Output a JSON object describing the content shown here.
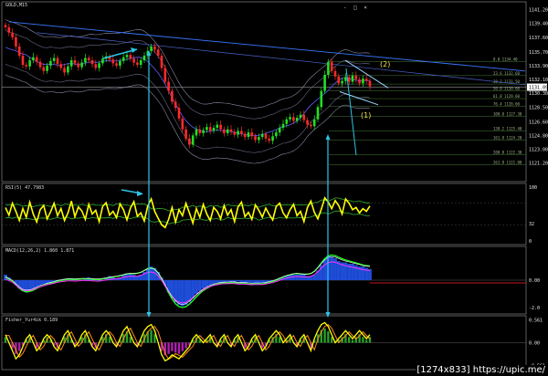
{
  "window": {
    "title": "GOLD,M15",
    "buttons": [
      "-",
      "□",
      "×"
    ]
  },
  "panels": {
    "rsi_title": "RSI(5) 47.7983",
    "macd_title": "MACD(12,26,2) 1.860 1.871",
    "fisher_title": "Fisher_Yur4ik 0.189"
  },
  "wave_labels": [
    "(2)",
    "(1)"
  ],
  "watermark": "[1274x833] https://upic.me/",
  "colors": {
    "background": "#000000",
    "bull_candle": "#22e022",
    "bear_candle": "#ff2a2a",
    "trendline": "#3a78ff",
    "arrow": "#2ec4e6",
    "rsi_line": "#ffff00",
    "fisher_line": "#ffff00",
    "macd_hist": "#1e4dd8",
    "fib": "#4a7a3a"
  },
  "chart_data": [
    {
      "type": "candlestick",
      "name": "price",
      "ylim": [
        1119.5,
        1141.5
      ],
      "y_ticks": [
        "1141.20",
        "1139.40",
        "1137.60",
        "1135.70",
        "1133.90",
        "1132.10",
        "1130.30",
        "1128.50",
        "1126.60",
        "1124.80",
        "1123.00",
        "1121.20"
      ],
      "highlight_price": "1131.09",
      "fib_levels": [
        {
          "label": "0.0",
          "value": 1134.4
        },
        {
          "label": "23.6",
          "value": 1132.6
        },
        {
          "label": "38.2",
          "value": 1131.5
        },
        {
          "label": "50.0",
          "value": 1130.6
        },
        {
          "label": "61.8",
          "value": 1129.6
        },
        {
          "label": "76.4",
          "value": 1128.6
        },
        {
          "label": "100.0",
          "value": 1127.3
        },
        {
          "label": "138.2",
          "value": 1125.4
        },
        {
          "label": "161.8",
          "value": 1124.2
        },
        {
          "label": "200.0",
          "value": 1122.3
        },
        {
          "label": "261.8",
          "value": 1121.0
        }
      ],
      "close": [
        1138.9,
        1138.2,
        1137.6,
        1136.4,
        1135.2,
        1134.0,
        1133.8,
        1134.6,
        1135.0,
        1134.4,
        1133.7,
        1133.2,
        1133.9,
        1134.5,
        1134.9,
        1134.1,
        1133.6,
        1133.0,
        1133.8,
        1134.6,
        1134.2,
        1133.7,
        1134.3,
        1134.9,
        1134.6,
        1134.1,
        1133.6,
        1134.2,
        1134.8,
        1135.1,
        1134.7,
        1134.2,
        1133.9,
        1134.5,
        1135.0,
        1135.3,
        1134.8,
        1134.3,
        1134.0,
        1134.6,
        1135.2,
        1135.8,
        1136.4,
        1136.0,
        1135.2,
        1133.6,
        1131.8,
        1130.6,
        1129.2,
        1128.4,
        1127.0,
        1125.6,
        1124.4,
        1123.6,
        1124.8,
        1125.6,
        1125.1,
        1125.5,
        1125.9,
        1125.4,
        1125.8,
        1126.2,
        1125.6,
        1125.1,
        1125.6,
        1125.3,
        1124.9,
        1125.4,
        1125.0,
        1124.6,
        1125.2,
        1124.7,
        1124.2,
        1124.6,
        1125.0,
        1124.4,
        1124.1,
        1124.7,
        1125.2,
        1125.8,
        1126.3,
        1126.9,
        1127.2,
        1126.7,
        1127.1,
        1127.5,
        1126.8,
        1126.2,
        1126.0,
        1126.9,
        1128.5,
        1130.6,
        1132.7,
        1134.4,
        1133.2,
        1132.5,
        1131.6,
        1131.9,
        1132.4,
        1131.8,
        1132.6,
        1132.1,
        1131.6,
        1132.2,
        1131.9,
        1131.2
      ]
    },
    {
      "type": "line",
      "name": "RSI",
      "ylim": [
        0,
        100
      ],
      "y_ticks": [
        "100",
        "32",
        "0"
      ],
      "values": [
        62,
        48,
        70,
        55,
        38,
        60,
        44,
        72,
        50,
        35,
        58,
        66,
        41,
        54,
        70,
        47,
        60,
        38,
        52,
        74,
        45,
        63,
        56,
        40,
        68,
        50,
        57,
        36,
        64,
        71,
        48,
        55,
        43,
        69,
        58,
        39,
        61,
        73,
        46,
        52,
        37,
        65,
        78,
        55,
        42,
        30,
        25,
        40,
        62,
        35,
        58,
        47,
        70,
        52,
        33,
        60,
        44,
        68,
        50,
        38,
        62,
        55,
        41,
        66,
        48,
        58,
        36,
        63,
        72,
        45,
        53,
        40,
        67,
        57,
        44,
        61,
        49,
        39,
        64,
        70,
        52,
        43,
        58,
        68,
        47,
        55,
        36,
        62,
        74,
        53,
        41,
        59,
        80,
        72,
        60,
        75,
        66,
        50,
        78,
        70,
        58,
        62,
        52,
        60,
        55,
        65
      ]
    },
    {
      "type": "bar",
      "name": "MACD",
      "ylim": [
        -2.2,
        2.2
      ],
      "y_ticks": [
        "0.00",
        "-2.0"
      ],
      "values": [
        0.4,
        0.2,
        0.0,
        -0.3,
        -0.6,
        -0.8,
        -0.9,
        -0.8,
        -0.6,
        -0.5,
        -0.4,
        -0.3,
        -0.3,
        -0.2,
        -0.1,
        -0.1,
        0.0,
        0.1,
        0.0,
        0.1,
        0.1,
        0.0,
        0.0,
        0.1,
        0.2,
        0.1,
        0.0,
        -0.1,
        0.0,
        0.2,
        0.3,
        0.2,
        0.1,
        0.2,
        0.4,
        0.5,
        0.5,
        0.4,
        0.3,
        0.4,
        0.6,
        0.8,
        1.0,
        0.9,
        0.6,
        0.2,
        -0.4,
        -0.9,
        -1.3,
        -1.6,
        -1.8,
        -1.9,
        -1.8,
        -1.6,
        -1.3,
        -1.0,
        -0.8,
        -0.6,
        -0.5,
        -0.4,
        -0.3,
        -0.2,
        -0.2,
        -0.2,
        -0.1,
        -0.2,
        -0.2,
        -0.1,
        -0.2,
        -0.3,
        -0.2,
        -0.2,
        -0.3,
        -0.3,
        -0.2,
        -0.2,
        -0.2,
        -0.1,
        0.0,
        0.1,
        0.2,
        0.3,
        0.4,
        0.4,
        0.4,
        0.5,
        0.4,
        0.3,
        0.3,
        0.4,
        0.7,
        1.1,
        1.5,
        1.8,
        1.7,
        1.6,
        1.4,
        1.3,
        1.3,
        1.2,
        1.2,
        1.1,
        1.0,
        1.0,
        0.9,
        0.8
      ]
    },
    {
      "type": "line",
      "name": "Fisher",
      "ylim": [
        -0.6,
        0.6
      ],
      "y_ticks": [
        "0.561",
        "0.00",
        "-0.561"
      ],
      "values": [
        0.2,
        0.0,
        -0.2,
        -0.4,
        -0.3,
        -0.1,
        0.1,
        0.2,
        0.0,
        -0.2,
        -0.1,
        0.1,
        0.2,
        0.1,
        -0.1,
        -0.2,
        0.0,
        0.2,
        0.3,
        0.1,
        -0.1,
        0.0,
        0.2,
        0.3,
        0.1,
        -0.1,
        -0.2,
        0.0,
        0.2,
        0.3,
        0.2,
        0.0,
        -0.1,
        0.1,
        0.3,
        0.4,
        0.2,
        0.0,
        -0.1,
        0.1,
        0.3,
        0.4,
        0.45,
        0.3,
        0.0,
        -0.3,
        -0.45,
        -0.4,
        -0.3,
        -0.35,
        -0.4,
        -0.3,
        -0.2,
        -0.1,
        0.1,
        0.2,
        0.1,
        0.0,
        0.1,
        0.2,
        0.0,
        -0.1,
        0.1,
        0.2,
        0.0,
        -0.1,
        0.1,
        0.2,
        0.0,
        -0.2,
        -0.1,
        0.1,
        0.2,
        0.0,
        -0.2,
        -0.1,
        0.1,
        0.2,
        0.3,
        0.2,
        0.0,
        0.1,
        0.2,
        0.0,
        -0.1,
        0.1,
        0.2,
        0.0,
        -0.2,
        0.1,
        0.3,
        0.45,
        0.5,
        0.4,
        0.2,
        0.0,
        0.1,
        0.2,
        0.3,
        0.2,
        0.1,
        0.2,
        0.3,
        0.2,
        0.1,
        0.2
      ]
    }
  ]
}
